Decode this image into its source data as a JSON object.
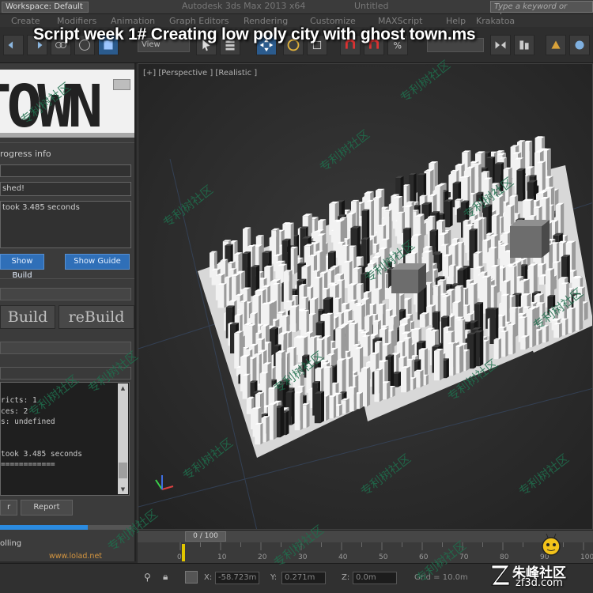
{
  "titlebar": {
    "workspace": "Workspace: Default",
    "app_title": "Autodesk 3ds Max  2013 x64",
    "doc_title": "Untitled",
    "search_placeholder": "Type a keyword or phrase"
  },
  "menu": [
    "Create",
    "Modifiers",
    "Animation",
    "Graph Editors",
    "Rendering",
    "Customize",
    "MAXScript",
    "Help",
    "Krakatoa"
  ],
  "toolbar": {
    "selection_set": "View",
    "create_selection_set": ""
  },
  "caption": "Script week 1# Creating low poly city with ghost town.ms",
  "left_panel": {
    "logo_text": "TOWN",
    "progress_info_label": "rogress info",
    "status_field": "shed!",
    "log_field": "took 3.485 seconds",
    "show_build_button": "Show Build",
    "show_guide_button": "Show Guide",
    "build_button": "Build",
    "rebuild_button": "reBuild",
    "listener_lines": [
      "ricts: 1",
      "ces: 2",
      "s: undefined",
      "",
      "",
      "took 3.485 seconds",
      "============"
    ],
    "clear_button": "r",
    "report_button": "Report",
    "progress_fraction": 0.67,
    "rolling_label": "olling",
    "website": "www.lolad.net"
  },
  "viewport": {
    "label": "[+] [Perspective ] [Realistic ]"
  },
  "timeline": {
    "frame_display": "0 / 100",
    "tick_numbers": [
      "0",
      "10",
      "20",
      "30",
      "40",
      "50",
      "60",
      "70",
      "80",
      "90",
      "100"
    ]
  },
  "statusbar": {
    "x_label": "X:",
    "x_value": "-58.723m",
    "y_label": "Y:",
    "y_value": "0.271m",
    "z_label": "Z:",
    "z_value": "0.0m",
    "grid": "Grid = 10.0m"
  },
  "watermarks": {
    "text": "专利树社区",
    "site_cn": "朱峰社区",
    "site_en": "zf3d.com"
  },
  "colors": {
    "accent_blue": "#2f6fb8",
    "key_yellow": "#e1c600",
    "watermark_green": "#1f6f4d"
  }
}
